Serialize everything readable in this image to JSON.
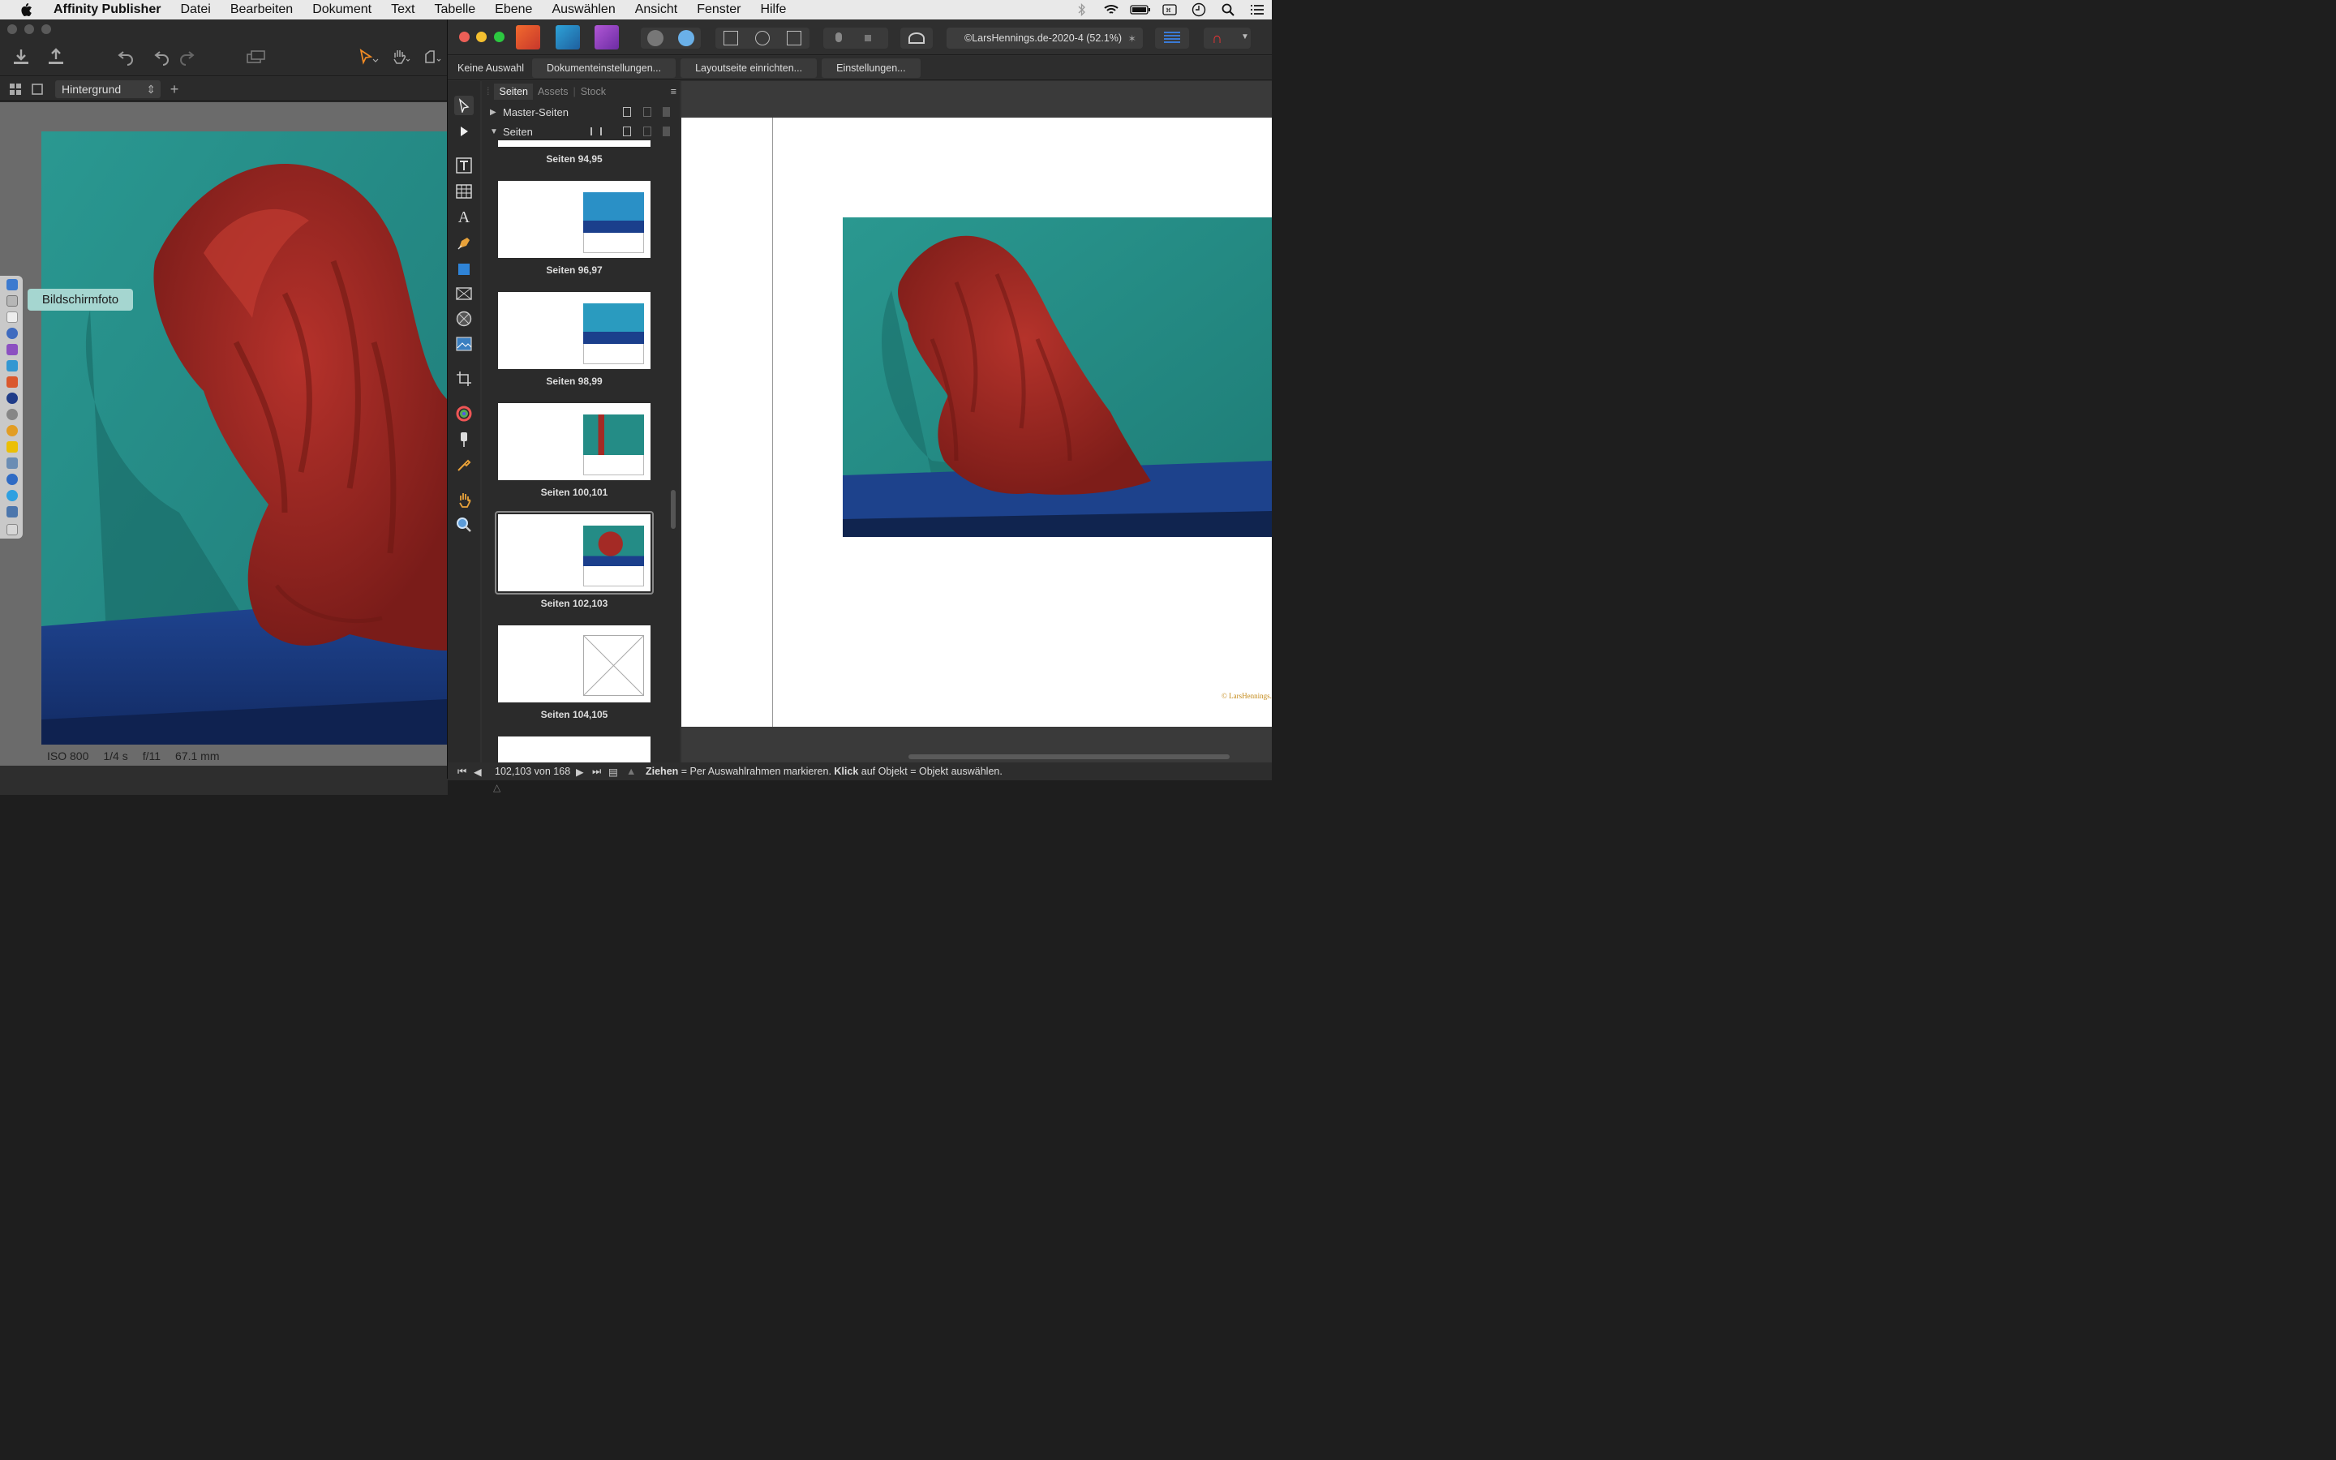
{
  "menubar": {
    "items": [
      "Datei",
      "Bearbeiten",
      "Dokument",
      "Text",
      "Tabelle",
      "Ebene",
      "Auswählen",
      "Ansicht",
      "Fenster",
      "Hilfe"
    ],
    "app": "Affinity Publisher"
  },
  "left_window": {
    "layer_select": "Hintergrund",
    "exif": {
      "iso": "ISO 800",
      "shutter": "1/4 s",
      "aperture": "f/11",
      "focal": "67.1 mm"
    },
    "tooltip": "Bildschirmfoto"
  },
  "right_window": {
    "doc_title": "©LarsHennings.de-2020-4 (52.1%)",
    "context": {
      "no_selection": "Keine Auswahl",
      "btn_doc": "Dokumenteinstellungen...",
      "btn_layout": "Layoutseite einrichten...",
      "btn_settings": "Einstellungen..."
    },
    "panel": {
      "tabs": [
        "Seiten",
        "Assets",
        "Stock"
      ],
      "master": "Master-Seiten",
      "pages": "Seiten",
      "captions": [
        "Seiten 94,95",
        "Seiten 96,97",
        "Seiten 98,99",
        "Seiten 100,101",
        "Seiten 102,103",
        "Seiten 104,105"
      ]
    },
    "copyright": "© LarsHennings.",
    "status": {
      "page": "102,103 von 168",
      "hint_drag": "Ziehen",
      "hint_drag_text": " = Per Auswahlrahmen markieren. ",
      "hint_click": "Klick",
      "hint_click_text": " auf Objekt = Objekt auswählen."
    }
  },
  "colors": {
    "teal": "#2c9a92",
    "red": "#a42a25",
    "blue": "#1c3f8a"
  }
}
